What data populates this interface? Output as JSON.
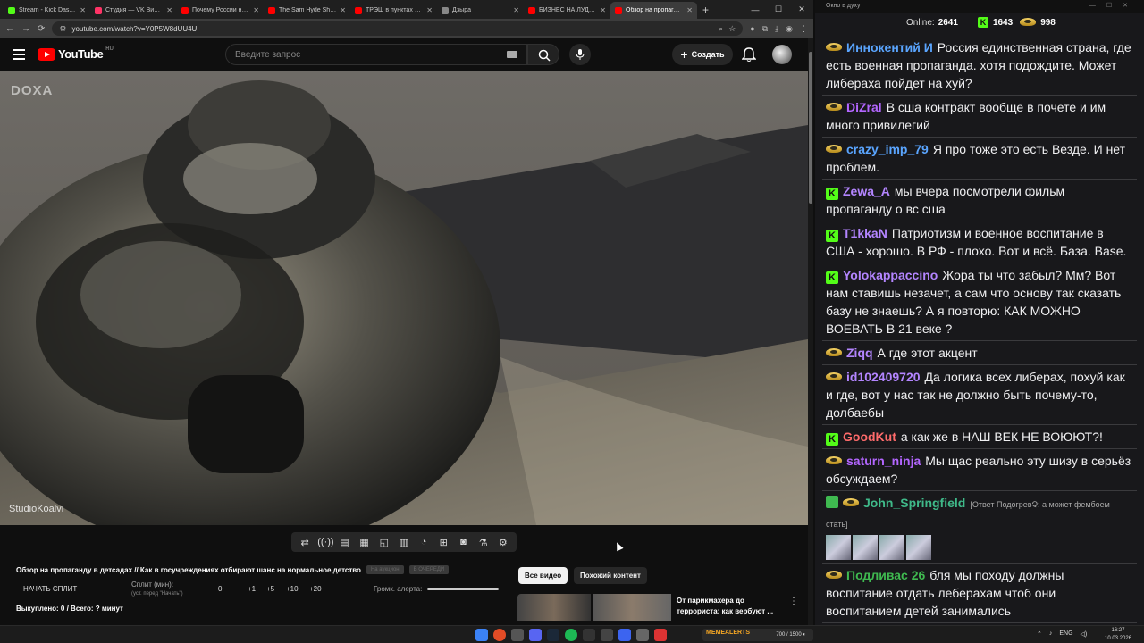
{
  "browser": {
    "tabs": [
      {
        "title": "Stream - Kick Dashboard",
        "color": "#53fc18"
      },
      {
        "title": "Студия — VK Видео Live",
        "color": "#ff3366"
      },
      {
        "title": "Почему России не дадут",
        "color": "#ff0000"
      },
      {
        "title": "The Sam Hyde Show D",
        "color": "#ff0000"
      },
      {
        "title": "ТРЭШ в пунктах выдачи",
        "color": "#ff0000"
      },
      {
        "title": "Дзыра",
        "color": "#888888"
      },
      {
        "title": "БИЗНЕС НА ЛУДОМАНАХ",
        "color": "#ff0000"
      },
      {
        "title": "Обзор на пропаганду в детсадах",
        "color": "#ff0000",
        "active": true
      }
    ],
    "url": "youtube.com/watch?v=Y0P5W8dUU4U"
  },
  "youtube": {
    "logo": "YouTube",
    "region": "RU",
    "search_placeholder": "Введите запрос",
    "create_label": "Создать"
  },
  "video": {
    "watermark_top": "DOXA",
    "watermark_bottom": "StudioKoalvi",
    "title": "Обзор на пропаганду в детсадах // Как в госучреждениях отбирают шанс на нормальное детство",
    "pill1": "На аукцион",
    "pill2": "В ОЧЕРЕДИ"
  },
  "split": {
    "start_label": "НАЧАТЬ СПЛИТ",
    "label": "Сплит (мин):",
    "hint": "(уст. перед \"Начать\")",
    "value": "0",
    "increments": [
      "+1",
      "+5",
      "+10",
      "+20"
    ],
    "alert_label": "Громк. алерта:",
    "bought": "Выкуплено: 0 / Всего: ? минут"
  },
  "sidebar": {
    "chip_all": "Все видео",
    "chip_similar": "Похожий контент",
    "rec_title": "От парикмахера до террориста: как вербуют ..."
  },
  "chat": {
    "window_title": "Окно в духу",
    "online_label": "Online:",
    "online_count": "2641",
    "kick_count": "1643",
    "crown_count": "998",
    "messages": [
      {
        "badge": "crown",
        "user": "Иннокентий И",
        "color": "#5aa5ff",
        "text": "Россия единственная страна, где есть военная пропаганда. хотя подождите. Может либераха пойдет на хуй?"
      },
      {
        "badge": "crown",
        "user": "DiZral",
        "color": "#b366ff",
        "text": "В сша контракт вообще в почете и им много привилегий"
      },
      {
        "badge": "crown",
        "user": "crazy_imp_79",
        "color": "#5aa5ff",
        "text": "Я про тоже это есть Везде. И нет проблем."
      },
      {
        "badge": "kick",
        "user": "Zewa_A",
        "color": "#b385ff",
        "text": "мы вчера посмотрели фильм пропаганду о вс сша"
      },
      {
        "badge": "kick",
        "user": "T1kkaN",
        "color": "#b385ff",
        "text": "Патриотизм и военное воспитание в США - хорошо. В РФ - плохо. Вот и всё. База. Base."
      },
      {
        "badge": "kick",
        "user": "Yolokappaccino",
        "color": "#b385ff",
        "text": "Жора ты что забыл? Мм? Вот нам ставишь незачет, а сам что основу так сказать базу не знаешь? А я повторю: КАК МОЖНО ВОЕВАТЬ В 21 веке ?"
      },
      {
        "badge": "crown",
        "user": "Ziqq",
        "color": "#b385ff",
        "text": "А где этот акцент"
      },
      {
        "badge": "crown",
        "user": "id102409720",
        "color": "#b385ff",
        "text": "Да логика всех либерах, похуй как и где, вот у нас так не должно быть почему-то, долбаебы"
      },
      {
        "badge": "kick",
        "user": "GoodKut",
        "color": "#ff6b6b",
        "text": "а как же в НАШ ВЕК НЕ ВОЮЮТ?!"
      },
      {
        "badge": "crown",
        "user": "saturn_ninja",
        "color": "#b366ff",
        "text": "Мы щас реально эту шизу в серьёз обсуждаем?"
      },
      {
        "badge": "crown",
        "user": "John_Springfield",
        "color": "#3fb989",
        "text": "",
        "reply": "[Ответ ПодогревՉ: а может фембоем стать]",
        "emotes": true
      },
      {
        "badge": "crown",
        "user": "Подливас 26",
        "color": "#3fb950",
        "text": "бля мы походу должны воспитание отдать леберахам чтоб они воспитанием детей занимались"
      }
    ]
  },
  "taskbar": {
    "lang": "ENG",
    "time": "16:27",
    "date": "10.03.2026",
    "widget_text": "700 / 1500 ◐",
    "widget_logo": "MEMEALERTS"
  }
}
